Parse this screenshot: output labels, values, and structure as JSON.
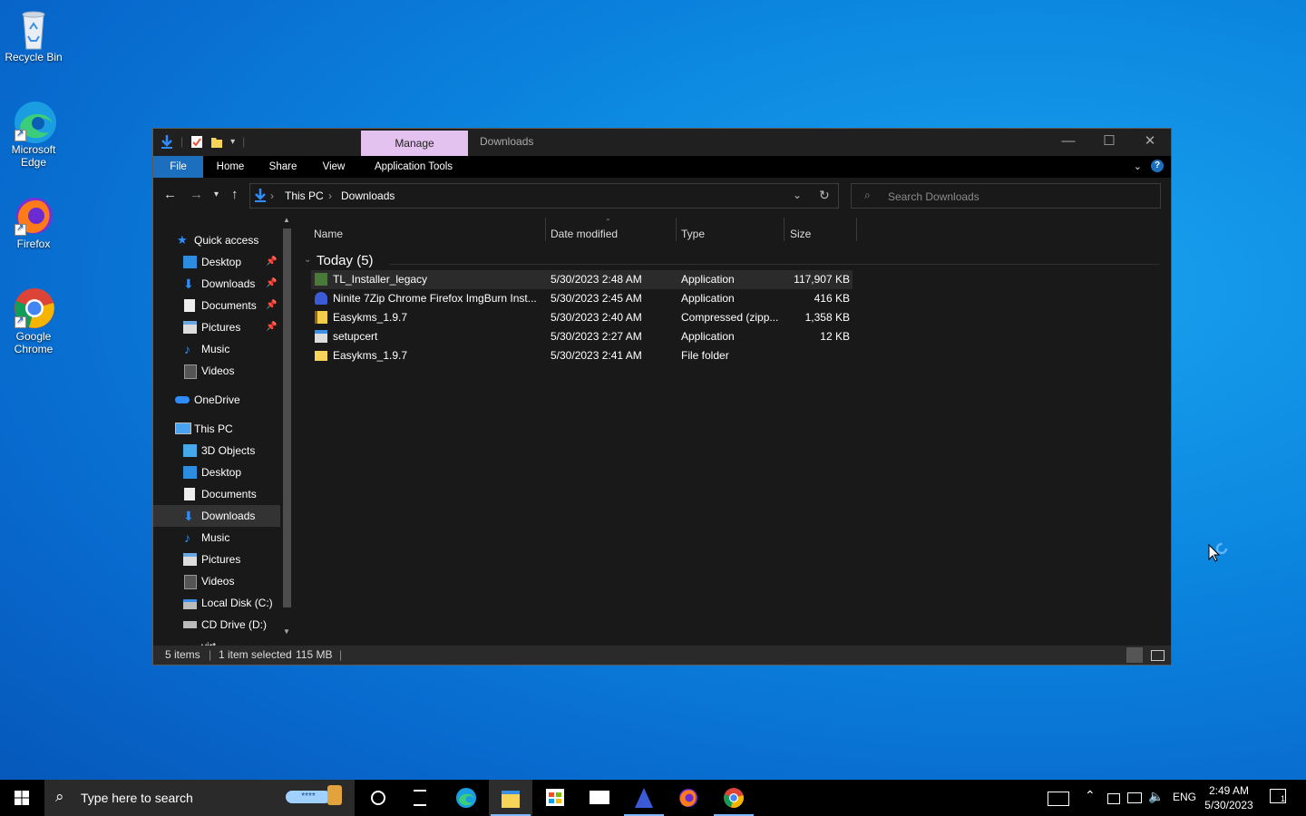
{
  "desktop": {
    "icons": [
      {
        "label": "Recycle Bin"
      },
      {
        "label": "Microsoft Edge"
      },
      {
        "label": "Firefox"
      },
      {
        "label": "Google Chrome"
      }
    ]
  },
  "window": {
    "title": "Downloads",
    "context_tab": "Manage",
    "ribbon_tabs": [
      "File",
      "Home",
      "Share",
      "View",
      "Application Tools"
    ],
    "address": {
      "crumbs": [
        "This PC",
        "Downloads"
      ]
    },
    "search_placeholder": "Search Downloads",
    "nav": {
      "quick_access": "Quick access",
      "quick_items": [
        "Desktop",
        "Downloads",
        "Documents",
        "Pictures",
        "Music",
        "Videos"
      ],
      "onedrive": "OneDrive",
      "this_pc": "This PC",
      "pc_items": [
        "3D Objects",
        "Desktop",
        "Documents",
        "Downloads",
        "Music",
        "Pictures",
        "Videos",
        "Local Disk (C:)",
        "CD Drive (D:) virt"
      ]
    },
    "columns": {
      "name": "Name",
      "date": "Date modified",
      "type": "Type",
      "size": "Size"
    },
    "group": "Today (5)",
    "files": [
      {
        "name": "TL_Installer_legacy",
        "date": "5/30/2023 2:48 AM",
        "type": "Application",
        "size": "117,907 KB"
      },
      {
        "name": "Ninite 7Zip Chrome Firefox ImgBurn Inst...",
        "date": "5/30/2023 2:45 AM",
        "type": "Application",
        "size": "416 KB"
      },
      {
        "name": "Easykms_1.9.7",
        "date": "5/30/2023 2:40 AM",
        "type": "Compressed (zipp...",
        "size": "1,358 KB"
      },
      {
        "name": "setupcert",
        "date": "5/30/2023 2:27 AM",
        "type": "Application",
        "size": "12 KB"
      },
      {
        "name": "Easykms_1.9.7",
        "date": "5/30/2023 2:41 AM",
        "type": "File folder",
        "size": ""
      }
    ],
    "status": {
      "count": "5 items",
      "selected": "1 item selected",
      "size": "115 MB"
    }
  },
  "taskbar": {
    "search_placeholder": "Type here to search",
    "lang": "ENG",
    "time": "2:49 AM",
    "date": "5/30/2023",
    "notif_count": "1"
  },
  "colors": {
    "accent": "#1b6fbe",
    "manage_tab": "#e4c2f0",
    "window_bg": "#191919"
  }
}
